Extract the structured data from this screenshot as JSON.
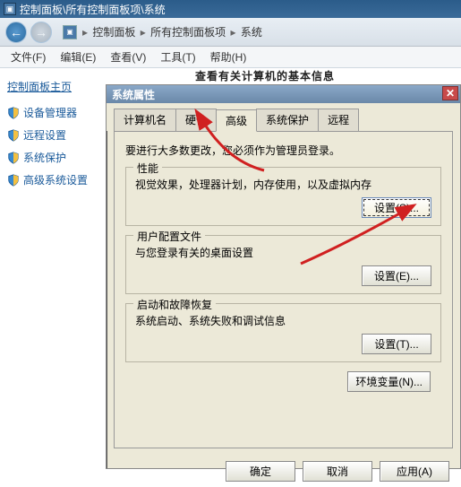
{
  "window": {
    "title": "控制面板\\所有控制面板项\\系统"
  },
  "breadcrumb": {
    "p1": "控制面板",
    "p2": "所有控制面板项",
    "p3": "系统"
  },
  "menu": {
    "file": "文件(F)",
    "edit": "编辑(E)",
    "view": "查看(V)",
    "tools": "工具(T)",
    "help": "帮助(H)"
  },
  "sidebar": {
    "header": "控制面板主页",
    "items": [
      {
        "label": "设备管理器"
      },
      {
        "label": "远程设置"
      },
      {
        "label": "系统保护"
      },
      {
        "label": "高级系统设置"
      }
    ]
  },
  "main_hidden": "查看有关计算机的基本信息",
  "dialog": {
    "title": "系统属性",
    "tabs": {
      "t0": "计算机名",
      "t1": "硬件",
      "t2": "高级",
      "t3": "系统保护",
      "t4": "远程"
    },
    "body": {
      "admin_note": "要进行大多数更改，您必须作为管理员登录。",
      "perf": {
        "label": "性能",
        "desc": "视觉效果，处理器计划，内存使用，以及虚拟内存",
        "btn": "设置(S)..."
      },
      "profile": {
        "label": "用户配置文件",
        "desc": "与您登录有关的桌面设置",
        "btn": "设置(E)..."
      },
      "startup": {
        "label": "启动和故障恢复",
        "desc": "系统启动、系统失败和调试信息",
        "btn": "设置(T)..."
      },
      "env_btn": "环境变量(N)..."
    },
    "buttons": {
      "ok": "确定",
      "cancel": "取消",
      "apply": "应用(A)"
    }
  }
}
